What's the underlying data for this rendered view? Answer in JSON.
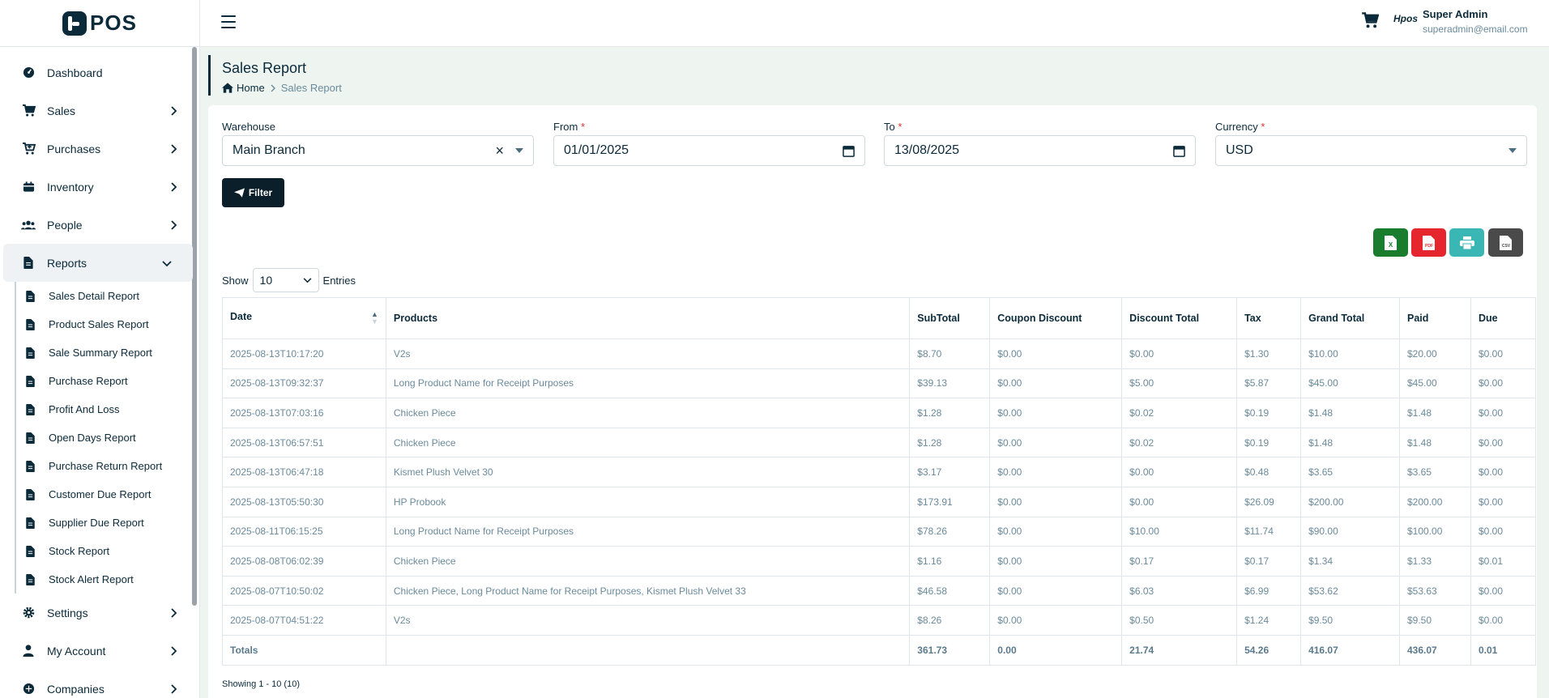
{
  "app": {
    "logo_text": "POS",
    "brand_icon_text": "Hpos"
  },
  "user": {
    "name": "Super Admin",
    "email": "superadmin@email.com"
  },
  "sidebar": {
    "items": [
      {
        "label": "Dashboard",
        "icon": "dashboard-icon"
      },
      {
        "label": "Sales",
        "icon": "cart-icon"
      },
      {
        "label": "Purchases",
        "icon": "cart-plus-icon"
      },
      {
        "label": "Inventory",
        "icon": "box-icon"
      },
      {
        "label": "People",
        "icon": "users-icon"
      },
      {
        "label": "Reports",
        "icon": "file-icon"
      }
    ],
    "report_items": [
      "Sales Detail Report",
      "Product Sales Report",
      "Sale Summary Report",
      "Purchase Report",
      "Profit And Loss",
      "Open Days Report",
      "Purchase Return Report",
      "Customer Due Report",
      "Supplier Due Report",
      "Stock Report",
      "Stock Alert Report"
    ],
    "bottom_items": [
      {
        "label": "Settings",
        "icon": "gear-icon"
      },
      {
        "label": "My Account",
        "icon": "user-icon"
      },
      {
        "label": "Companies",
        "icon": "building-icon"
      }
    ]
  },
  "page": {
    "title": "Sales Report",
    "breadcrumb_home": "Home",
    "breadcrumb_current": "Sales Report"
  },
  "filters": {
    "warehouse_label": "Warehouse",
    "warehouse_value": "Main Branch",
    "from_label": "From",
    "from_value": "01/01/2025",
    "to_label": "To",
    "to_value": "13/08/2025",
    "currency_label": "Currency",
    "currency_value": "USD",
    "required_mark": "*",
    "clear_mark": "×",
    "filter_button": "Filter"
  },
  "exports": {
    "excel": "X",
    "pdf": "PDF",
    "csv": "CSV"
  },
  "table_controls": {
    "show_label": "Show",
    "page_size": "10",
    "entries_label": "Entries",
    "showing_text": "Showing 1 - 10 (10)"
  },
  "table": {
    "columns": [
      "Date",
      "Products",
      "SubTotal",
      "Coupon Discount",
      "Discount Total",
      "Tax",
      "Grand Total",
      "Paid",
      "Due"
    ],
    "rows": [
      [
        "2025-08-13T10:17:20",
        "V2s",
        "$8.70",
        "$0.00",
        "$0.00",
        "$1.30",
        "$10.00",
        "$20.00",
        "$0.00"
      ],
      [
        "2025-08-13T09:32:37",
        "Long Product Name for Receipt Purposes",
        "$39.13",
        "$0.00",
        "$5.00",
        "$5.87",
        "$45.00",
        "$45.00",
        "$0.00"
      ],
      [
        "2025-08-13T07:03:16",
        "Chicken Piece",
        "$1.28",
        "$0.00",
        "$0.02",
        "$0.19",
        "$1.48",
        "$1.48",
        "$0.00"
      ],
      [
        "2025-08-13T06:57:51",
        "Chicken Piece",
        "$1.28",
        "$0.00",
        "$0.02",
        "$0.19",
        "$1.48",
        "$1.48",
        "$0.00"
      ],
      [
        "2025-08-13T06:47:18",
        "Kismet Plush Velvet 30",
        "$3.17",
        "$0.00",
        "$0.00",
        "$0.48",
        "$3.65",
        "$3.65",
        "$0.00"
      ],
      [
        "2025-08-13T05:50:30",
        "HP Probook",
        "$173.91",
        "$0.00",
        "$0.00",
        "$26.09",
        "$200.00",
        "$200.00",
        "$0.00"
      ],
      [
        "2025-08-11T06:15:25",
        "Long Product Name for Receipt Purposes",
        "$78.26",
        "$0.00",
        "$10.00",
        "$11.74",
        "$90.00",
        "$100.00",
        "$0.00"
      ],
      [
        "2025-08-08T06:02:39",
        "Chicken Piece",
        "$1.16",
        "$0.00",
        "$0.17",
        "$0.17",
        "$1.34",
        "$1.33",
        "$0.01"
      ],
      [
        "2025-08-07T10:50:02",
        "Chicken Piece, Long Product Name for Receipt Purposes, Kismet Plush Velvet 33",
        "$46.58",
        "$0.00",
        "$6.03",
        "$6.99",
        "$53.62",
        "$53.63",
        "$0.00"
      ],
      [
        "2025-08-07T04:51:22",
        "V2s",
        "$8.26",
        "$0.00",
        "$0.50",
        "$1.24",
        "$9.50",
        "$9.50",
        "$0.00"
      ]
    ],
    "totals": [
      "Totals",
      "",
      "361.73",
      "0.00",
      "21.74",
      "54.26",
      "416.07",
      "436.07",
      "0.01"
    ]
  },
  "colors": {
    "primary": "#0b2a3a",
    "excel": "#1a7d2d",
    "pdf": "#e5262f",
    "print": "#3ab6b4",
    "csv": "#4a4a4a"
  }
}
